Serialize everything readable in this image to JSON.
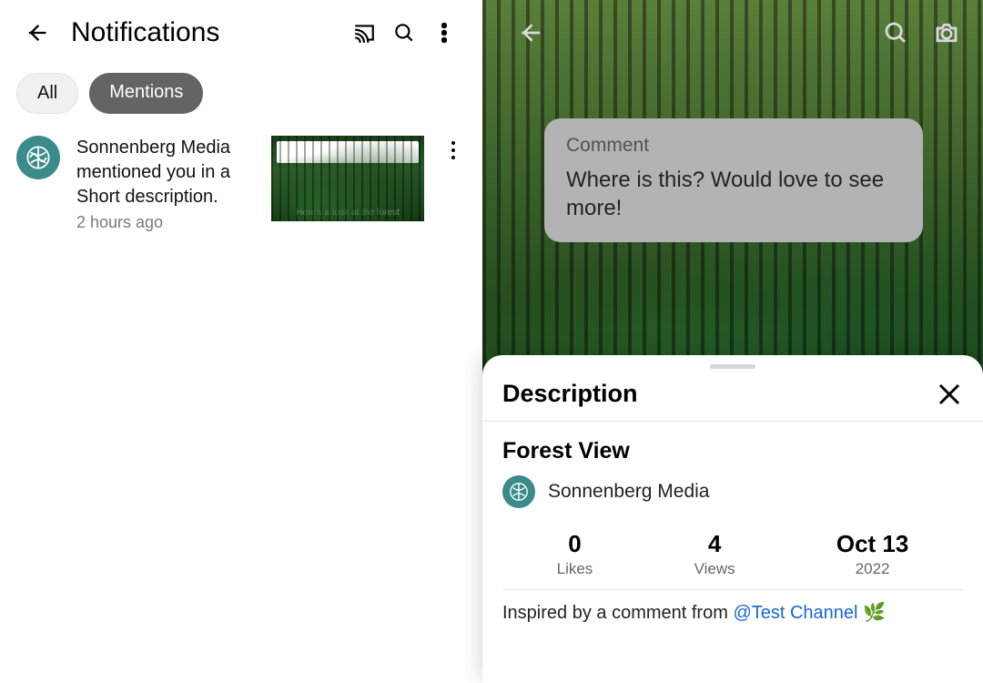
{
  "left": {
    "title": "Notifications",
    "tabs": {
      "all": "All",
      "mentions": "Mentions"
    },
    "item": {
      "line1": "Sonnenberg Media",
      "line2": "mentioned you in a",
      "line3": "Short description.",
      "time": "2 hours ago",
      "thumb_caption": "Here's a look at the forest"
    }
  },
  "right": {
    "comment_label": "Comment",
    "comment_body": "Where is this? Would love to see more!",
    "sheet": {
      "title": "Description",
      "video_title": "Forest View",
      "channel": "Sonnenberg Media",
      "stats": {
        "likes_value": "0",
        "likes_label": "Likes",
        "views_value": "4",
        "views_label": "Views",
        "date_value": "Oct 13",
        "date_label": "2022"
      },
      "caption_prefix": "Inspired by a comment from ",
      "caption_mention": "@Test Channel",
      "caption_suffix_emoji": "🌿"
    }
  }
}
